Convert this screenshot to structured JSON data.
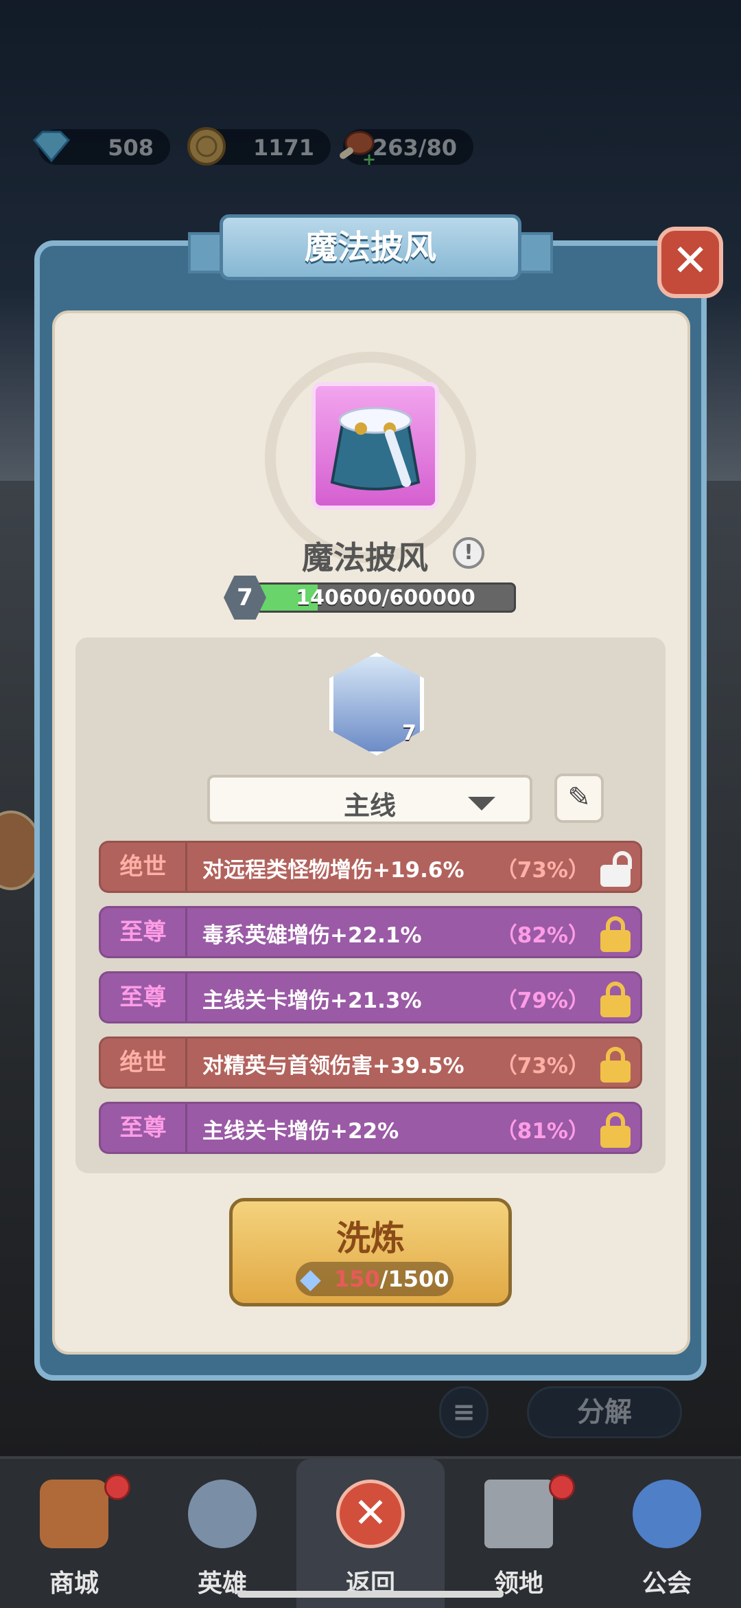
{
  "resources": {
    "gems": "508",
    "coins": "1171",
    "stamina": "263/80"
  },
  "popup": {
    "title": "魔法披风",
    "close_icon": "close-icon"
  },
  "item": {
    "name": "魔法披风",
    "level": "7",
    "xp_text": "140600/600000",
    "xp_fraction": 0.234,
    "rune_level": "7"
  },
  "filter": {
    "selected": "主线"
  },
  "affixes": [
    {
      "tier": "绝世",
      "text": "对远程类怪物增伤+19.6%",
      "pct": "（73%）",
      "color": "red",
      "locked": false
    },
    {
      "tier": "至尊",
      "text": "毒系英雄增伤+22.1%",
      "pct": "（82%）",
      "color": "purple",
      "locked": true
    },
    {
      "tier": "至尊",
      "text": "主线关卡增伤+21.3%",
      "pct": "（79%）",
      "color": "purple",
      "locked": true
    },
    {
      "tier": "绝世",
      "text": "对精英与首领伤害+39.5%",
      "pct": "（73%）",
      "color": "red",
      "locked": true
    },
    {
      "tier": "至尊",
      "text": "主线关卡增伤+22%",
      "pct": "（81%）",
      "color": "purple",
      "locked": true
    }
  ],
  "refine": {
    "label": "洗炼",
    "cost_have": "150",
    "cost_need": "/1500"
  },
  "behind": {
    "decompose": "分解"
  },
  "nav": [
    {
      "label": "商城",
      "dot": true
    },
    {
      "label": "英雄",
      "dot": false
    },
    {
      "label": "返回",
      "dot": false
    },
    {
      "label": "领地",
      "dot": true
    },
    {
      "label": "公会",
      "dot": false
    }
  ]
}
